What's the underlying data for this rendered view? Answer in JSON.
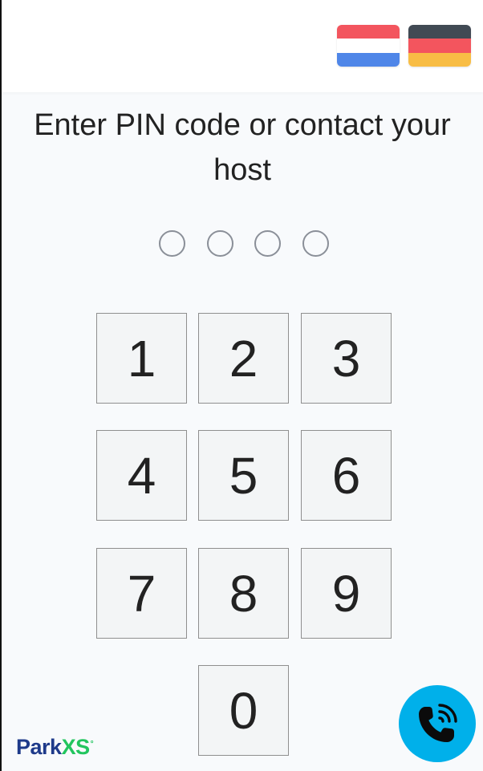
{
  "languages": [
    {
      "code": "nl",
      "icon": "netherlands-flag-icon",
      "colors": [
        "#f3555e",
        "#ffffff",
        "#4f86e8"
      ]
    },
    {
      "code": "de",
      "icon": "germany-flag-icon",
      "colors": [
        "#414a54",
        "#f3555e",
        "#f8bd45"
      ]
    }
  ],
  "prompt": {
    "line1": "Enter PIN code or contact your",
    "line2": "host"
  },
  "pin": {
    "length": 4,
    "entered": 0
  },
  "keypad": {
    "keys": [
      "1",
      "2",
      "3",
      "4",
      "5",
      "6",
      "7",
      "8",
      "9",
      "0"
    ]
  },
  "brand": {
    "part1": "Park",
    "part2": "XS",
    "mark": "°",
    "colors": {
      "primary": "#1e3a8a",
      "accent": "#22c55e"
    }
  },
  "call_button": {
    "icon": "phone-ringing-icon",
    "color": "#00b0ea"
  }
}
